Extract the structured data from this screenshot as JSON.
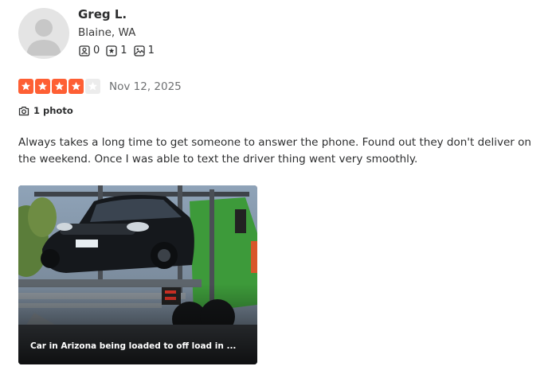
{
  "reviewer": {
    "name": "Greg L.",
    "location": "Blaine, WA",
    "stats": [
      {
        "icon": "friends-icon",
        "count": "0"
      },
      {
        "icon": "reviews-star-icon",
        "count": "1"
      },
      {
        "icon": "photos-icon",
        "count": "1"
      }
    ]
  },
  "review": {
    "rating": 4,
    "max_rating": 5,
    "date": "Nov 12, 2025",
    "photo_count_label": "1 photo",
    "text": "Always takes a long time to get someone to answer the phone. Found out they don't deliver on the weekend. Once I was able to text the driver thing went very smoothly."
  },
  "photo": {
    "caption": "Car in Arizona being loaded to off load in ..."
  },
  "colors": {
    "star_active": "#fe5f34",
    "star_inactive": "#ececec"
  }
}
